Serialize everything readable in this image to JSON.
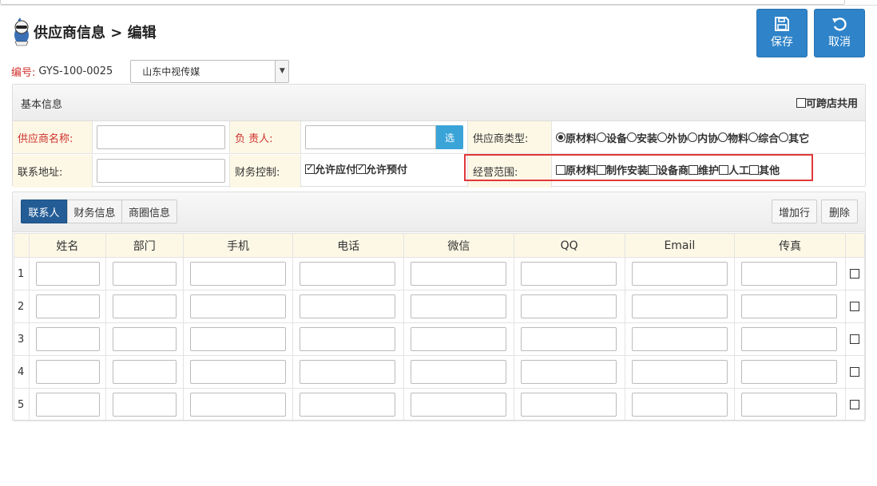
{
  "header": {
    "title": "供应商信息 > 编辑"
  },
  "actions": {
    "save_label": "保存",
    "cancel_label": "取消"
  },
  "code": {
    "label": "编号:",
    "value": "GYS-100-0025",
    "store_select_value": "山东中视传媒"
  },
  "basic": {
    "title": "基本信息",
    "cross_store_label": "可跨店共用",
    "cross_store_checked": false,
    "name_label": "供应商名称:",
    "owner_label": "负 责人:",
    "select_button": "选",
    "type_label": "供应商类型:",
    "type_options": [
      {
        "label": "原材料",
        "checked": true
      },
      {
        "label": "设备",
        "checked": false
      },
      {
        "label": "安装",
        "checked": false
      },
      {
        "label": "外协",
        "checked": false
      },
      {
        "label": "内协",
        "checked": false
      },
      {
        "label": "物料",
        "checked": false
      },
      {
        "label": "综合",
        "checked": false
      },
      {
        "label": "其它",
        "checked": false
      }
    ],
    "address_label": "联系地址:",
    "finance_label": "财务控制:",
    "finance_options": [
      {
        "label": "允许应付",
        "checked": true
      },
      {
        "label": "允许预付",
        "checked": true
      }
    ],
    "scope_label": "经营范围:",
    "scope_options": [
      {
        "label": "原材料",
        "checked": false
      },
      {
        "label": "制作安装",
        "checked": false
      },
      {
        "label": "设备商",
        "checked": false
      },
      {
        "label": "维护",
        "checked": false
      },
      {
        "label": "人工",
        "checked": false
      },
      {
        "label": "其他",
        "checked": false
      }
    ]
  },
  "contacts": {
    "tabs": [
      {
        "label": "联系人",
        "active": true
      },
      {
        "label": "财务信息",
        "active": false
      },
      {
        "label": "商圈信息",
        "active": false
      }
    ],
    "add_row_label": "增加行",
    "delete_label": "删除",
    "columns": [
      "姓名",
      "部门",
      "手机",
      "电话",
      "微信",
      "QQ",
      "Email",
      "传真"
    ],
    "row_numbers": [
      "1",
      "2",
      "3",
      "4",
      "5"
    ]
  },
  "colors": {
    "primary": "#2f83c8",
    "tab_active": "#245d96",
    "label_bg": "#fdf8e6",
    "required_red": "#d0312d",
    "highlight_border": "#e0383a"
  }
}
